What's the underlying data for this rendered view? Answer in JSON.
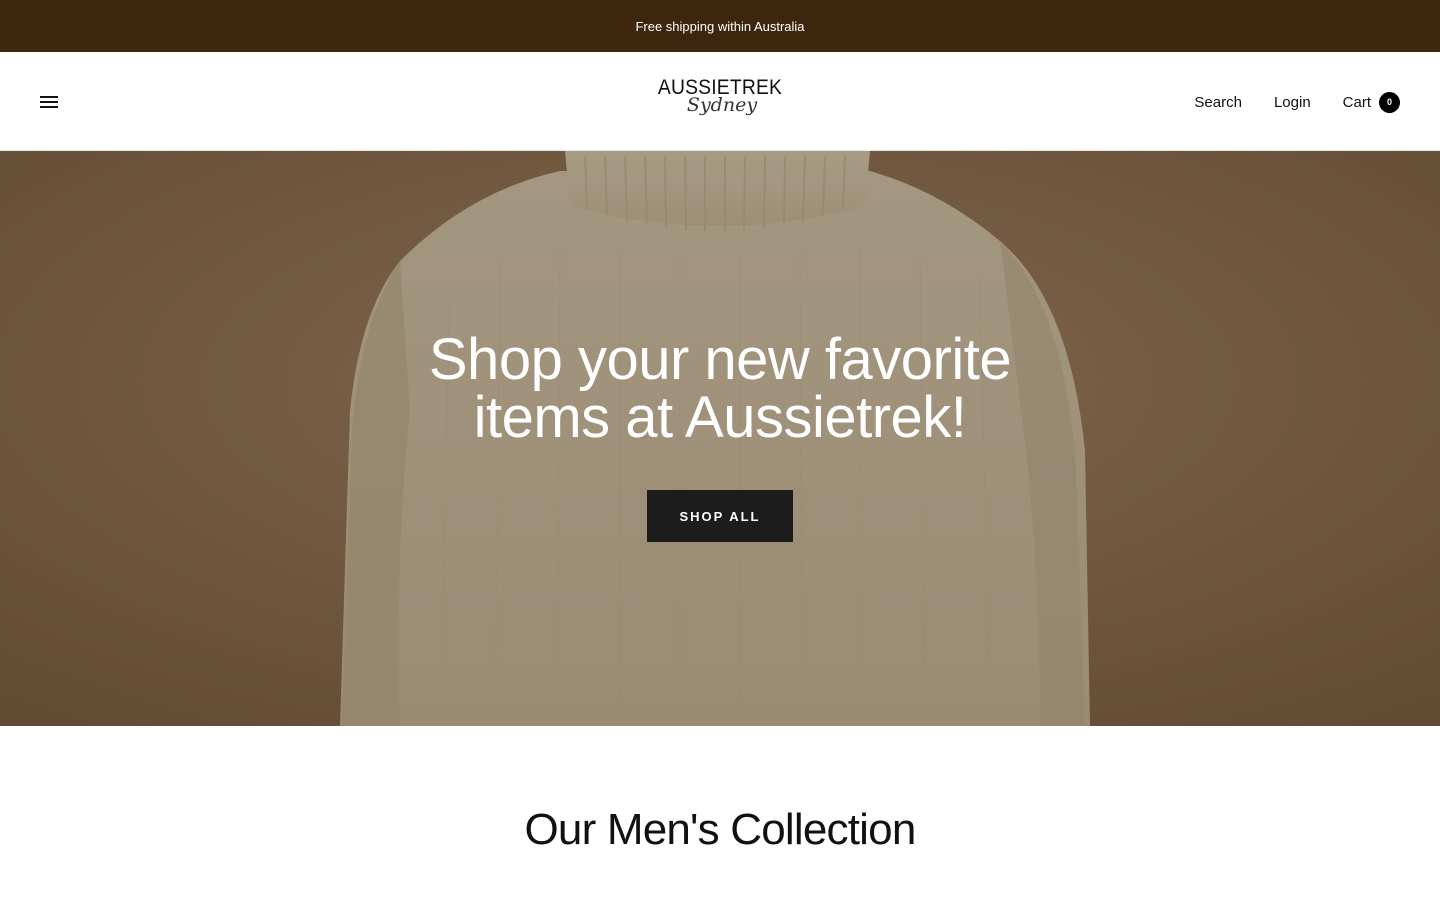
{
  "announcement": {
    "text": "Free shipping within Australia"
  },
  "header": {
    "menu_icon": "hamburger-menu-icon",
    "logo": {
      "top": "AUSSIETREK",
      "bottom": "Sydney"
    },
    "nav": {
      "search": "Search",
      "login": "Login",
      "cart": "Cart",
      "cart_count": "0"
    }
  },
  "hero": {
    "title_line1": "Shop your new favorite",
    "title_line2": "items at Aussietrek!",
    "button_label": "SHOP ALL"
  },
  "collection": {
    "title": "Our Men's Collection"
  },
  "colors": {
    "announcement_bg": "#3e250d",
    "button_bg": "#1c1c1c"
  }
}
